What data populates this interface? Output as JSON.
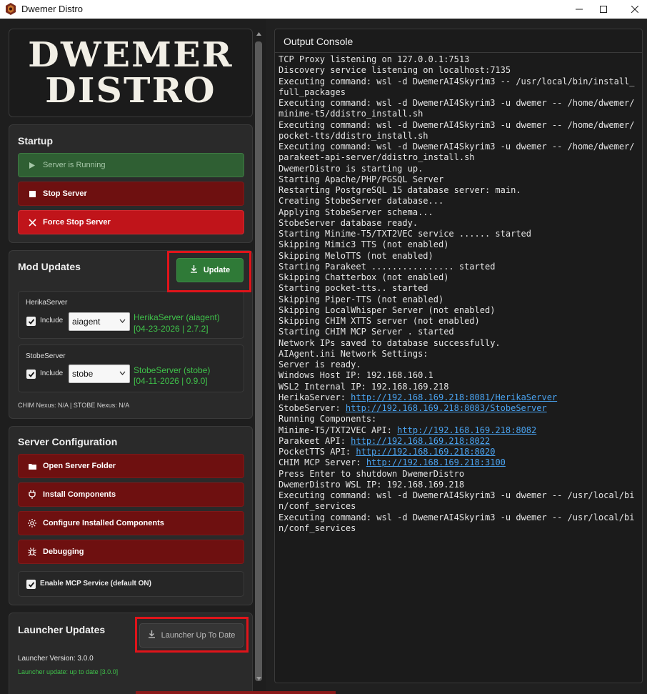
{
  "window": {
    "title": "Dwemer Distro",
    "icon": "dwemer-app-icon",
    "controls": [
      "minimize-icon",
      "maximize-icon",
      "close-icon"
    ]
  },
  "logo": {
    "line1": "DWEMER",
    "line2": "DISTRO"
  },
  "startup": {
    "title": "Startup",
    "running_label": "Server is Running",
    "stop_label": "Stop Server",
    "force_stop_label": "Force Stop Server"
  },
  "mod_updates": {
    "title": "Mod Updates",
    "update_label": "Update",
    "herika": {
      "title": "HerikaServer",
      "include_label": "Include",
      "include_checked": true,
      "select_value": "aiagent",
      "version_name": "HerikaServer (aiagent)",
      "version_date": "[04-23-2026 | 2.7.2]"
    },
    "stobe": {
      "title": "StobeServer",
      "include_label": "Include",
      "include_checked": true,
      "select_value": "stobe",
      "version_name": "StobeServer (stobe)",
      "version_date": "[04-11-2026 | 0.9.0]"
    },
    "nexus_text": "CHIM Nexus: N/A | STOBE Nexus: N/A"
  },
  "server_config": {
    "title": "Server Configuration",
    "open_folder_label": "Open Server Folder",
    "install_label": "Install Components",
    "configure_label": "Configure Installed Components",
    "debugging_label": "Debugging",
    "mcp_label": "Enable MCP Service (default ON)",
    "mcp_checked": true
  },
  "launcher": {
    "title": "Launcher Updates",
    "button_label": "Launcher Up To Date",
    "version_text": "Launcher Version: 3.0.0",
    "update_status": "Launcher update: up to date [3.0.0]"
  },
  "console": {
    "title": "Output Console",
    "link_color": "#4aa3f0",
    "lines": [
      {
        "text": "TCP Proxy listening on 127.0.0.1:7513"
      },
      {
        "text": "Discovery service listening on localhost:7135"
      },
      {
        "text": "Executing command: wsl -d DwemerAI4Skyrim3 -- /usr/local/bin/install_full_packages"
      },
      {
        "text": "Executing command: wsl -d DwemerAI4Skyrim3 -u dwemer -- /home/dwemer/minime-t5/ddistro_install.sh"
      },
      {
        "text": "Executing command: wsl -d DwemerAI4Skyrim3 -u dwemer -- /home/dwemer/pocket-tts/ddistro_install.sh"
      },
      {
        "text": "Executing command: wsl -d DwemerAI4Skyrim3 -u dwemer -- /home/dwemer/parakeet-api-server/ddistro_install.sh"
      },
      {
        "text": "DwemerDistro is starting up."
      },
      {
        "text": "Starting Apache/PHP/PGSQL Server"
      },
      {
        "text": "Restarting PostgreSQL 15 database server: main."
      },
      {
        "text": "Creating StobeServer database..."
      },
      {
        "text": "Applying StobeServer schema..."
      },
      {
        "text": "StobeServer database ready."
      },
      {
        "text": "Starting Minime-T5/TXT2VEC service ...... started"
      },
      {
        "text": "Skipping Mimic3 TTS (not enabled)"
      },
      {
        "text": "Skipping MeloTTS (not enabled)"
      },
      {
        "text": "Starting Parakeet ................ started"
      },
      {
        "text": "Skipping Chatterbox (not enabled)"
      },
      {
        "text": "Starting pocket-tts.. started"
      },
      {
        "text": "Skipping Piper-TTS (not enabled)"
      },
      {
        "text": "Skipping LocalWhisper Server (not enabled)"
      },
      {
        "text": "Skipping CHIM XTTS server (not enabled)"
      },
      {
        "text": "Starting CHIM MCP Server . started"
      },
      {
        "text": "Network IPs saved to database successfully."
      },
      {
        "text": "AIAgent.ini Network Settings:"
      },
      {
        "text": "Server is ready."
      },
      {
        "text": "Windows Host IP: 192.168.160.1"
      },
      {
        "text": "WSL2 Internal IP: 192.168.169.218"
      },
      {
        "text": "HerikaServer: ",
        "link": "http://192.168.169.218:8081/HerikaServer"
      },
      {
        "text": "StobeServer: ",
        "link": "http://192.168.169.218:8083/StobeServer"
      },
      {
        "text": "Running Components:"
      },
      {
        "text": "Minime-T5/TXT2VEC API: ",
        "link": "http://192.168.169.218:8082"
      },
      {
        "text": "Parakeet API: ",
        "link": "http://192.168.169.218:8022"
      },
      {
        "text": "PocketTTS API: ",
        "link": "http://192.168.169.218:8020"
      },
      {
        "text": "CHIM MCP Server: ",
        "link": "http://192.168.169.218:3100"
      },
      {
        "text": "Press Enter to shutdown DwemerDistro"
      },
      {
        "text": "DwemerDistro WSL IP: 192.168.169.218"
      },
      {
        "text": "Executing command: wsl -d DwemerAI4Skyrim3 -u dwemer -- /usr/local/bin/conf_services"
      },
      {
        "text": "Executing command: wsl -d DwemerAI4Skyrim3 -u dwemer -- /usr/local/bin/conf_services"
      }
    ]
  }
}
